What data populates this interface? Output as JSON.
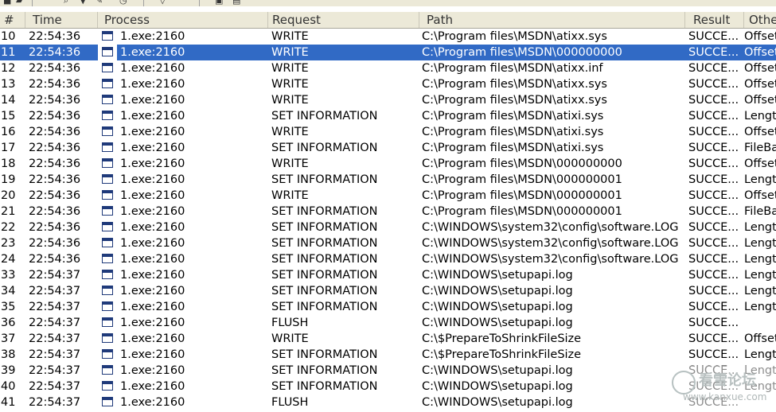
{
  "columns": [
    "#",
    "Time",
    "Process",
    "Request",
    "Path",
    "Result",
    "Othe"
  ],
  "selected_row_index": 1,
  "rows": [
    {
      "num": "10",
      "time": "22:54:36",
      "process": "1.exe:2160",
      "request": "WRITE",
      "path": "C:\\Program files\\MSDN\\atixx.sys",
      "result": "SUCCE...",
      "other": "Offset"
    },
    {
      "num": "11",
      "time": "22:54:36",
      "process": "1.exe:2160",
      "request": "WRITE",
      "path": "C:\\Program files\\MSDN\\000000000",
      "result": "SUCCE...",
      "other": "Offset"
    },
    {
      "num": "12",
      "time": "22:54:36",
      "process": "1.exe:2160",
      "request": "WRITE",
      "path": "C:\\Program files\\MSDN\\atixx.inf",
      "result": "SUCCE...",
      "other": "Offset"
    },
    {
      "num": "13",
      "time": "22:54:36",
      "process": "1.exe:2160",
      "request": "WRITE",
      "path": "C:\\Program files\\MSDN\\atixx.sys",
      "result": "SUCCE...",
      "other": "Offset"
    },
    {
      "num": "14",
      "time": "22:54:36",
      "process": "1.exe:2160",
      "request": "WRITE",
      "path": "C:\\Program files\\MSDN\\atixx.sys",
      "result": "SUCCE...",
      "other": "Offset"
    },
    {
      "num": "15",
      "time": "22:54:36",
      "process": "1.exe:2160",
      "request": "SET INFORMATION",
      "path": "C:\\Program files\\MSDN\\atixi.sys",
      "result": "SUCCE...",
      "other": "Length"
    },
    {
      "num": "16",
      "time": "22:54:36",
      "process": "1.exe:2160",
      "request": "WRITE",
      "path": "C:\\Program files\\MSDN\\atixi.sys",
      "result": "SUCCE...",
      "other": "Offset"
    },
    {
      "num": "17",
      "time": "22:54:36",
      "process": "1.exe:2160",
      "request": "SET INFORMATION",
      "path": "C:\\Program files\\MSDN\\atixi.sys",
      "result": "SUCCE...",
      "other": "FileBa"
    },
    {
      "num": "18",
      "time": "22:54:36",
      "process": "1.exe:2160",
      "request": "WRITE",
      "path": "C:\\Program files\\MSDN\\000000000",
      "result": "SUCCE...",
      "other": "Offset"
    },
    {
      "num": "19",
      "time": "22:54:36",
      "process": "1.exe:2160",
      "request": "SET INFORMATION",
      "path": "C:\\Program files\\MSDN\\000000001",
      "result": "SUCCE...",
      "other": "Length"
    },
    {
      "num": "20",
      "time": "22:54:36",
      "process": "1.exe:2160",
      "request": "WRITE",
      "path": "C:\\Program files\\MSDN\\000000001",
      "result": "SUCCE...",
      "other": "Offset"
    },
    {
      "num": "21",
      "time": "22:54:36",
      "process": "1.exe:2160",
      "request": "SET INFORMATION",
      "path": "C:\\Program files\\MSDN\\000000001",
      "result": "SUCCE...",
      "other": "FileBa"
    },
    {
      "num": "22",
      "time": "22:54:36",
      "process": "1.exe:2160",
      "request": "SET INFORMATION",
      "path": "C:\\WINDOWS\\system32\\config\\software.LOG",
      "result": "SUCCE...",
      "other": "Length"
    },
    {
      "num": "23",
      "time": "22:54:36",
      "process": "1.exe:2160",
      "request": "SET INFORMATION",
      "path": "C:\\WINDOWS\\system32\\config\\software.LOG",
      "result": "SUCCE...",
      "other": "Length"
    },
    {
      "num": "24",
      "time": "22:54:36",
      "process": "1.exe:2160",
      "request": "SET INFORMATION",
      "path": "C:\\WINDOWS\\system32\\config\\software.LOG",
      "result": "SUCCE...",
      "other": "Length"
    },
    {
      "num": "33",
      "time": "22:54:37",
      "process": "1.exe:2160",
      "request": "SET INFORMATION",
      "path": "C:\\WINDOWS\\setupapi.log",
      "result": "SUCCE...",
      "other": "Length"
    },
    {
      "num": "34",
      "time": "22:54:37",
      "process": "1.exe:2160",
      "request": "SET INFORMATION",
      "path": "C:\\WINDOWS\\setupapi.log",
      "result": "SUCCE...",
      "other": "Length"
    },
    {
      "num": "35",
      "time": "22:54:37",
      "process": "1.exe:2160",
      "request": "SET INFORMATION",
      "path": "C:\\WINDOWS\\setupapi.log",
      "result": "SUCCE...",
      "other": "Length"
    },
    {
      "num": "36",
      "time": "22:54:37",
      "process": "1.exe:2160",
      "request": "FLUSH",
      "path": "C:\\WINDOWS\\setupapi.log",
      "result": "SUCCE...",
      "other": ""
    },
    {
      "num": "37",
      "time": "22:54:37",
      "process": "1.exe:2160",
      "request": "WRITE",
      "path": "C:\\$PrepareToShrinkFileSize",
      "result": "SUCCE...",
      "other": "Offset"
    },
    {
      "num": "38",
      "time": "22:54:37",
      "process": "1.exe:2160",
      "request": "SET INFORMATION",
      "path": "C:\\$PrepareToShrinkFileSize",
      "result": "SUCCE...",
      "other": "Length"
    },
    {
      "num": "39",
      "time": "22:54:37",
      "process": "1.exe:2160",
      "request": "SET INFORMATION",
      "path": "C:\\WINDOWS\\setupapi.log",
      "result": "SUCCE...",
      "other": "Length"
    },
    {
      "num": "40",
      "time": "22:54:37",
      "process": "1.exe:2160",
      "request": "SET INFORMATION",
      "path": "C:\\WINDOWS\\setupapi.log",
      "result": "SUCCE...",
      "other": "Length"
    },
    {
      "num": "41",
      "time": "22:54:37",
      "process": "1.exe:2160",
      "request": "FLUSH",
      "path": "C:\\WINDOWS\\setupapi.log",
      "result": "SUCCE...",
      "other": ""
    }
  ],
  "watermark": {
    "text": "看雪论坛",
    "url": "www.kanxue.com"
  }
}
